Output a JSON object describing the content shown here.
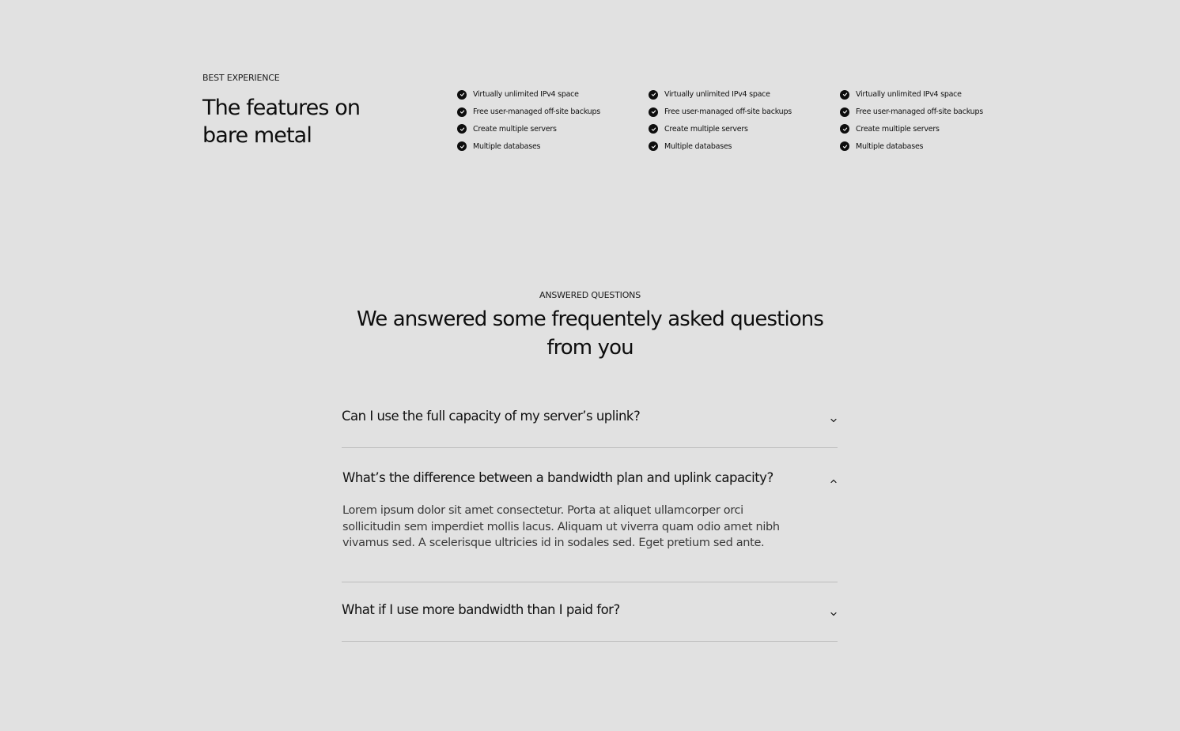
{
  "features": {
    "eyebrow": "BEST EXPERIENCE",
    "title": "The features on bare metal",
    "columns": [
      [
        "Virtually unlimited IPv4 space",
        "Free user-managed off-site backups",
        "Create multiple servers",
        "Multiple databases"
      ],
      [
        "Virtually unlimited IPv4 space",
        "Free user-managed off-site backups",
        "Create multiple servers",
        "Multiple databases"
      ],
      [
        "Virtually unlimited IPv4 space",
        "Free user-managed off-site backups",
        "Create multiple servers",
        "Multiple databases"
      ]
    ],
    "item_icon": "check-circle-icon"
  },
  "faq": {
    "eyebrow": "ANSWERED QUESTIONS",
    "title": "We answered some frequentely asked questions from you",
    "items": [
      {
        "question": "Can I use the full capacity of my server’s uplink?",
        "expanded": false,
        "icon": "chevron-down-icon"
      },
      {
        "question": "What’s the difference between a bandwidth plan and uplink capacity?",
        "expanded": true,
        "icon": "chevron-up-icon",
        "answer": "Lorem ipsum dolor sit amet consectetur. Porta at aliquet ullamcorper orci sollicitudin sem imperdiet mollis lacus. Aliquam ut viverra quam odio amet nibh vivamus sed. A scelerisque ultricies id in sodales sed. Eget pretium sed ante."
      },
      {
        "question": "What if I use more bandwidth than I paid for?",
        "expanded": false,
        "icon": "chevron-down-icon"
      }
    ]
  },
  "colors": {
    "background": "#e1e1e1",
    "text": "#0d0d0d",
    "divider": "#bdbdbd",
    "answer_text": "#3a3a3a"
  }
}
